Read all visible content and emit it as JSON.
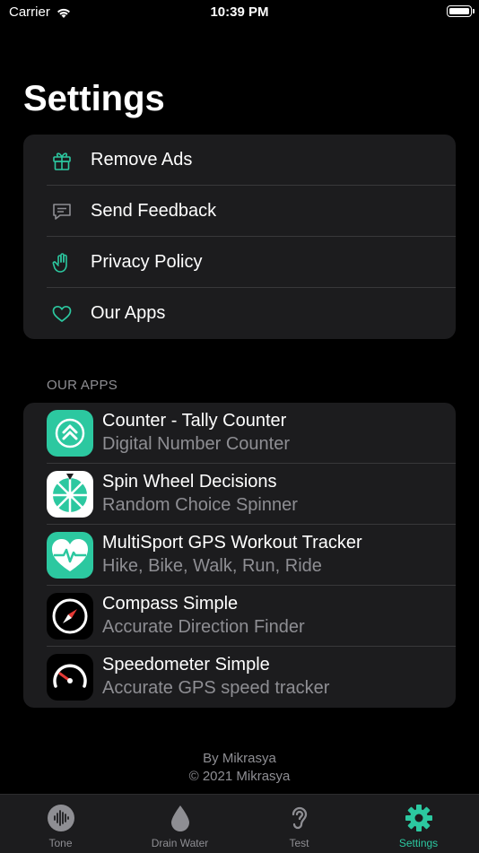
{
  "status_bar": {
    "carrier": "Carrier",
    "time": "10:39 PM"
  },
  "page": {
    "title": "Settings"
  },
  "menu": {
    "items": [
      {
        "label": "Remove Ads",
        "icon": "gift-icon"
      },
      {
        "label": "Send Feedback",
        "icon": "chat-bubble-icon"
      },
      {
        "label": "Privacy Policy",
        "icon": "hand-raised-icon"
      },
      {
        "label": "Our Apps",
        "icon": "heart-icon"
      }
    ]
  },
  "our_apps": {
    "header": "OUR APPS",
    "items": [
      {
        "title": "Counter - Tally Counter",
        "subtitle": "Digital Number Counter",
        "icon": "counter-app-icon"
      },
      {
        "title": "Spin Wheel Decisions",
        "subtitle": "Random Choice Spinner",
        "icon": "spin-wheel-app-icon"
      },
      {
        "title": "MultiSport GPS Workout Tracker",
        "subtitle": "Hike, Bike, Walk, Run, Ride",
        "icon": "heart-pulse-app-icon"
      },
      {
        "title": "Compass Simple",
        "subtitle": "Accurate Direction Finder",
        "icon": "compass-app-icon"
      },
      {
        "title": "Speedometer Simple",
        "subtitle": "Accurate GPS speed tracker",
        "icon": "speedometer-app-icon"
      }
    ]
  },
  "footer": {
    "line1": "By Mikrasya",
    "line2": "© 2021 Mikrasya"
  },
  "tab_bar": {
    "tabs": [
      {
        "label": "Tone",
        "icon": "waveform-icon"
      },
      {
        "label": "Drain Water",
        "icon": "drop-icon"
      },
      {
        "label": "Test",
        "icon": "ear-icon"
      },
      {
        "label": "Settings",
        "icon": "gear-icon"
      }
    ],
    "active": "Settings"
  },
  "colors": {
    "accent": "#2cc8a0",
    "background": "#000000",
    "card": "#1c1c1e",
    "secondary_text": "#8e8e93"
  }
}
